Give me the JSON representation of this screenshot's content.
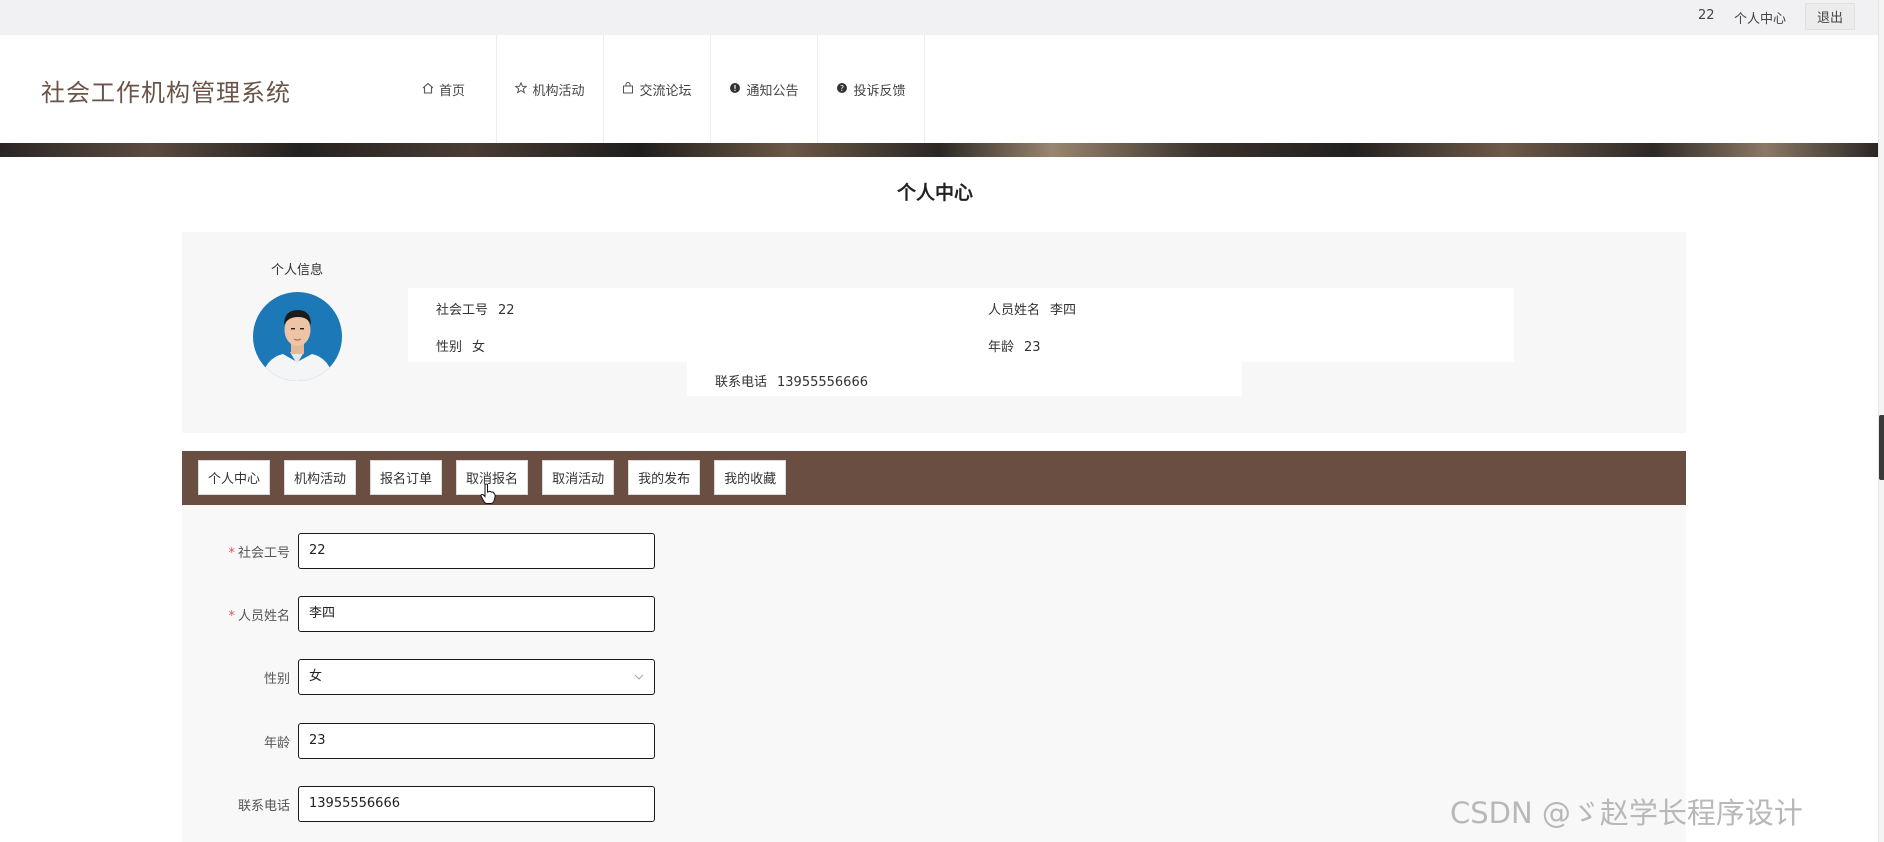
{
  "topbar": {
    "user_id": "22",
    "personal_center": "个人中心",
    "logout": "退出"
  },
  "header": {
    "site_title": "社会工作机构管理系统",
    "nav": [
      {
        "label": "首页",
        "icon": "home-icon"
      },
      {
        "label": "机构活动",
        "icon": "star-icon"
      },
      {
        "label": "交流论坛",
        "icon": "bag-icon"
      },
      {
        "label": "通知公告",
        "icon": "info-icon"
      },
      {
        "label": "投诉反馈",
        "icon": "question-icon"
      }
    ]
  },
  "page": {
    "title": "个人中心"
  },
  "profile": {
    "section_label": "个人信息",
    "fields": {
      "work_id_label": "社会工号",
      "work_id": "22",
      "name_label": "人员姓名",
      "name": "李四",
      "gender_label": "性别",
      "gender": "女",
      "age_label": "年龄",
      "age": "23",
      "phone_label": "联系电话",
      "phone": "13955556666"
    }
  },
  "tabs": [
    "个人中心",
    "机构活动",
    "报名订单",
    "取消报名",
    "取消活动",
    "我的发布",
    "我的收藏"
  ],
  "form": {
    "work_id": {
      "label": "社会工号",
      "value": "22",
      "required": true
    },
    "name": {
      "label": "人员姓名",
      "value": "李四",
      "required": true
    },
    "gender": {
      "label": "性别",
      "value": "女",
      "required": false
    },
    "age": {
      "label": "年龄",
      "value": "23",
      "required": false
    },
    "phone": {
      "label": "联系电话",
      "value": "13955556666",
      "required": false
    }
  },
  "watermark": "CSDN @ゞ赵学长程序设计",
  "colors": {
    "tab_bar": "#6a4e42",
    "title": "#6a5448",
    "required": "#e05555"
  }
}
